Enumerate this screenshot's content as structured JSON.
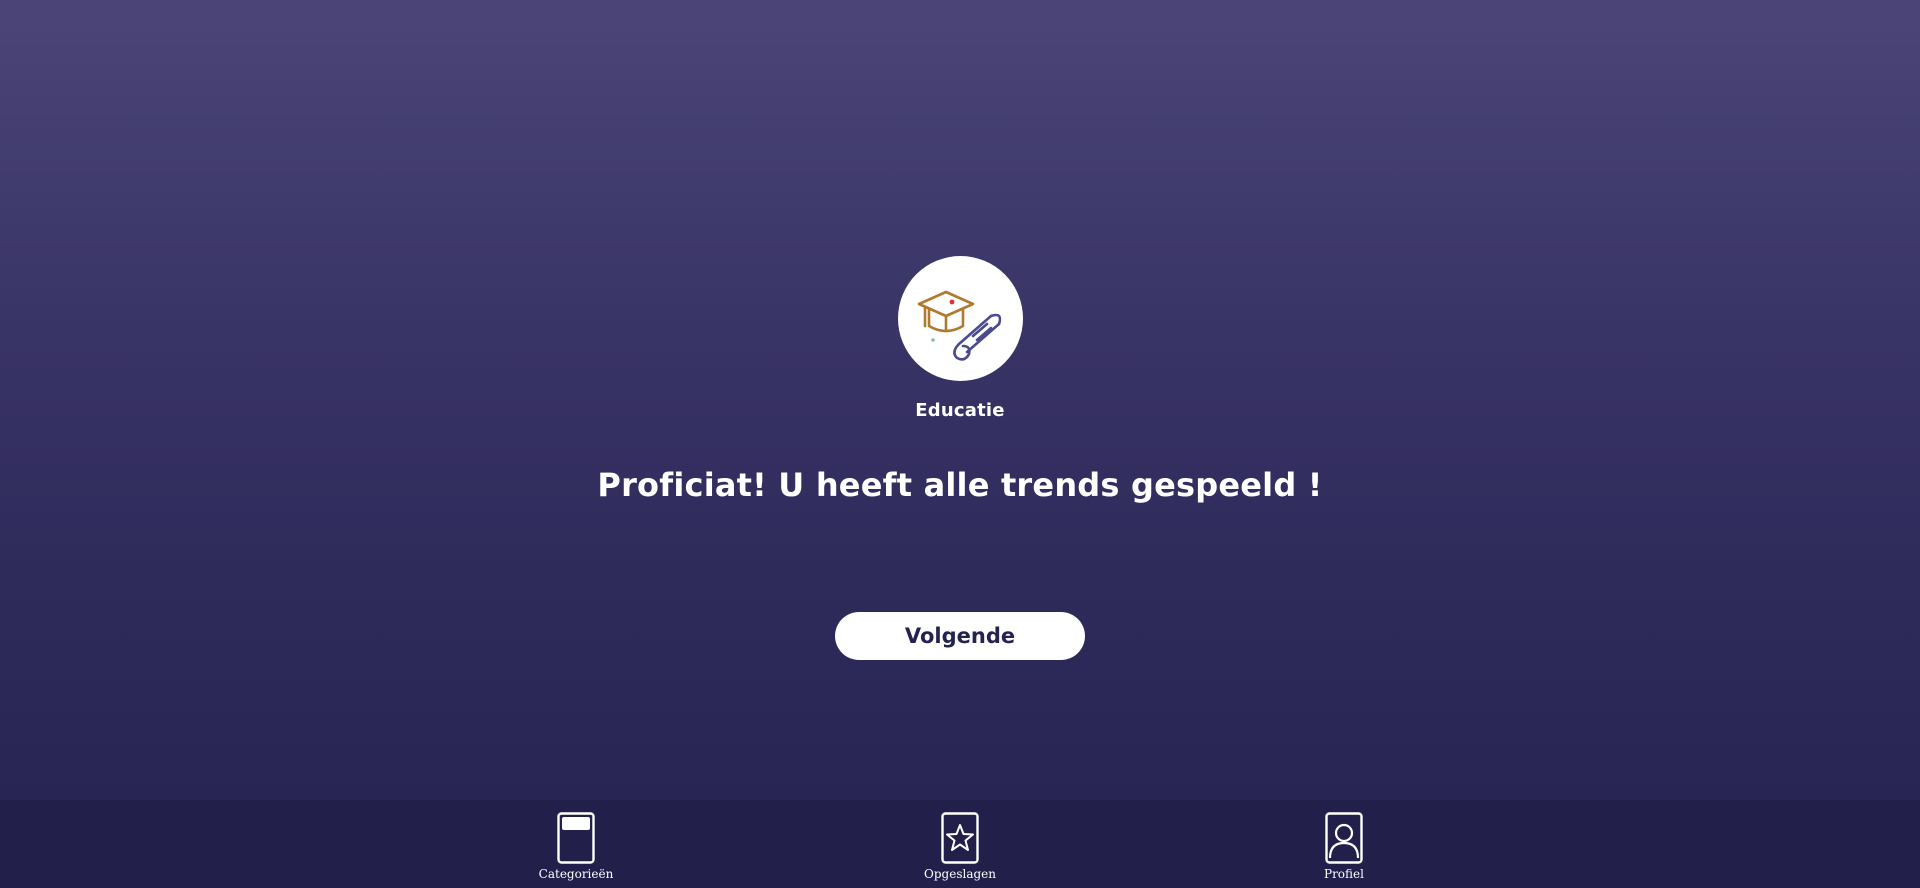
{
  "category": {
    "label": "Educatie",
    "icon": "graduation-cap-diploma-icon"
  },
  "message": {
    "headline": "Proficiat! U heeft alle trends gespeeld !"
  },
  "actions": {
    "next_label": "Volgende"
  },
  "bottom_nav": {
    "items": [
      {
        "label": "Categorieën",
        "icon": "category-card-icon"
      },
      {
        "label": "Opgeslagen",
        "icon": "star-card-icon"
      },
      {
        "label": "Profiel",
        "icon": "profile-card-icon"
      }
    ]
  },
  "colors": {
    "background_top": "#4b4578",
    "background_bottom": "#262250",
    "nav_background": "#231f4b",
    "button_text": "#26224f",
    "cap_color": "#b07a2e",
    "diploma_color": "#4a4a8e",
    "tassel_dot": "#e03030"
  }
}
